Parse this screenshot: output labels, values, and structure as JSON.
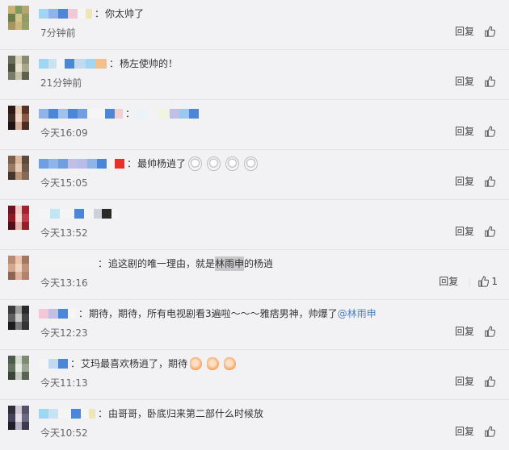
{
  "labels": {
    "reply": "回复"
  },
  "comments": [
    {
      "text": "你太帅了",
      "time": "7分钟前",
      "like_count": ""
    },
    {
      "text": "杨左使帅的！",
      "time": "21分钟前",
      "like_count": ""
    },
    {
      "text": "",
      "time": "今天16:09",
      "like_count": ""
    },
    {
      "text": "最帅杨逍了",
      "time": "今天15:05",
      "like_count": ""
    },
    {
      "text": "",
      "time": "今天13:52",
      "like_count": ""
    },
    {
      "text_before": "追这剧的唯一理由，就是",
      "text_highlight": "林雨申",
      "text_after": "的杨逍",
      "time": "今天13:16",
      "like_count": "1"
    },
    {
      "text": "期待，期待，所有电视剧看3遍啦～～～雅痞男神，帅爆了",
      "mention": "@林雨申",
      "time": "今天12:23",
      "like_count": ""
    },
    {
      "text": "艾玛最喜欢杨逍了，期待",
      "time": "今天11:13",
      "like_count": ""
    },
    {
      "text": "由哥哥，卧底归来第二部什么时候放",
      "time": "今天10:52",
      "like_count": ""
    }
  ],
  "icons": {
    "like": "thumbs-up-icon",
    "bear_emoji": "bear-face-emoji",
    "hand_emoji": "hand-emoji"
  },
  "colors": {
    "background": "#f2f2f5",
    "link": "#4a7fc1",
    "text": "#333333",
    "meta": "#666666"
  }
}
